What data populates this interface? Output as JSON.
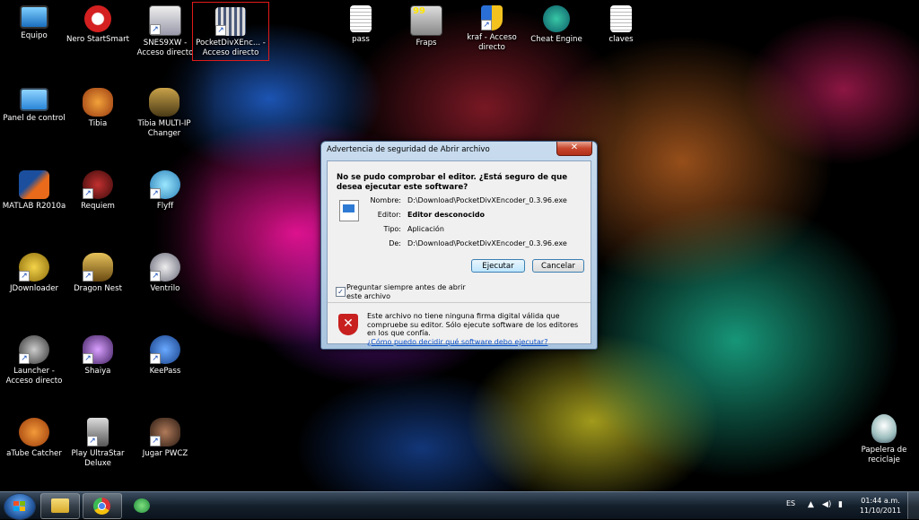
{
  "desktop": {
    "icons": [
      {
        "label": "Equipo",
        "shortcut": false
      },
      {
        "label": "Nero StartSmart",
        "shortcut": false
      },
      {
        "label": "SNES9XW - Acceso directo",
        "shortcut": true
      },
      {
        "label": "PocketDivXEnc... - Acceso directo",
        "shortcut": true
      },
      {
        "label": "pass",
        "shortcut": false
      },
      {
        "label": "Fraps",
        "shortcut": false
      },
      {
        "label": "kraf - Acceso directo",
        "shortcut": true
      },
      {
        "label": "Cheat Engine",
        "shortcut": false
      },
      {
        "label": "claves",
        "shortcut": false
      },
      {
        "label": "Panel de control",
        "shortcut": false
      },
      {
        "label": "Tibia",
        "shortcut": false
      },
      {
        "label": "Tibia MULTI-IP Changer",
        "shortcut": false
      },
      {
        "label": "MATLAB R2010a",
        "shortcut": false
      },
      {
        "label": "Requiem",
        "shortcut": true
      },
      {
        "label": "Flyff",
        "shortcut": true
      },
      {
        "label": "JDownloader",
        "shortcut": true
      },
      {
        "label": "Dragon Nest",
        "shortcut": true
      },
      {
        "label": "Ventrilo",
        "shortcut": true
      },
      {
        "label": "Launcher - Acceso directo",
        "shortcut": true
      },
      {
        "label": "Shaiya",
        "shortcut": true
      },
      {
        "label": "KeePass",
        "shortcut": true
      },
      {
        "label": "aTube Catcher",
        "shortcut": false
      },
      {
        "label": "Play UltraStar Deluxe",
        "shortcut": true
      },
      {
        "label": "Jugar PWCZ",
        "shortcut": true
      },
      {
        "label": "Papelera de reciclaje",
        "shortcut": false
      }
    ],
    "fraps_badge": "99"
  },
  "dialog": {
    "title": "Advertencia de seguridad de Abrir archivo",
    "close_glyph": "✕",
    "heading": "No se pudo comprobar el editor. ¿Está seguro de que desea ejecutar este software?",
    "props": {
      "name_label": "Nombre:",
      "name_value": "D:\\Download\\PocketDivXEncoder_0.3.96.exe",
      "publisher_label": "Editor:",
      "publisher_value": "Editor desconocido",
      "type_label": "Tipo:",
      "type_value": "Aplicación",
      "from_label": "De:",
      "from_value": "D:\\Download\\PocketDivXEncoder_0.3.96.exe"
    },
    "run_button": "Ejecutar",
    "cancel_button": "Cancelar",
    "checkbox_label": "Preguntar siempre antes de abrir este archivo",
    "checkbox_checked": true,
    "warning_text": "Este archivo no tiene ninguna firma digital válida que compruebe su editor. Sólo ejecute software de los editores en los que confía.",
    "warning_link": "¿Cómo puedo decidir qué software debo ejecutar?",
    "warning_glyph": "✕"
  },
  "taskbar": {
    "language": "ES",
    "time": "01:44 a.m.",
    "date": "11/10/2011"
  },
  "colors": {
    "accent_arrow": "#c81414",
    "selection_frame": "#e01a1a"
  }
}
